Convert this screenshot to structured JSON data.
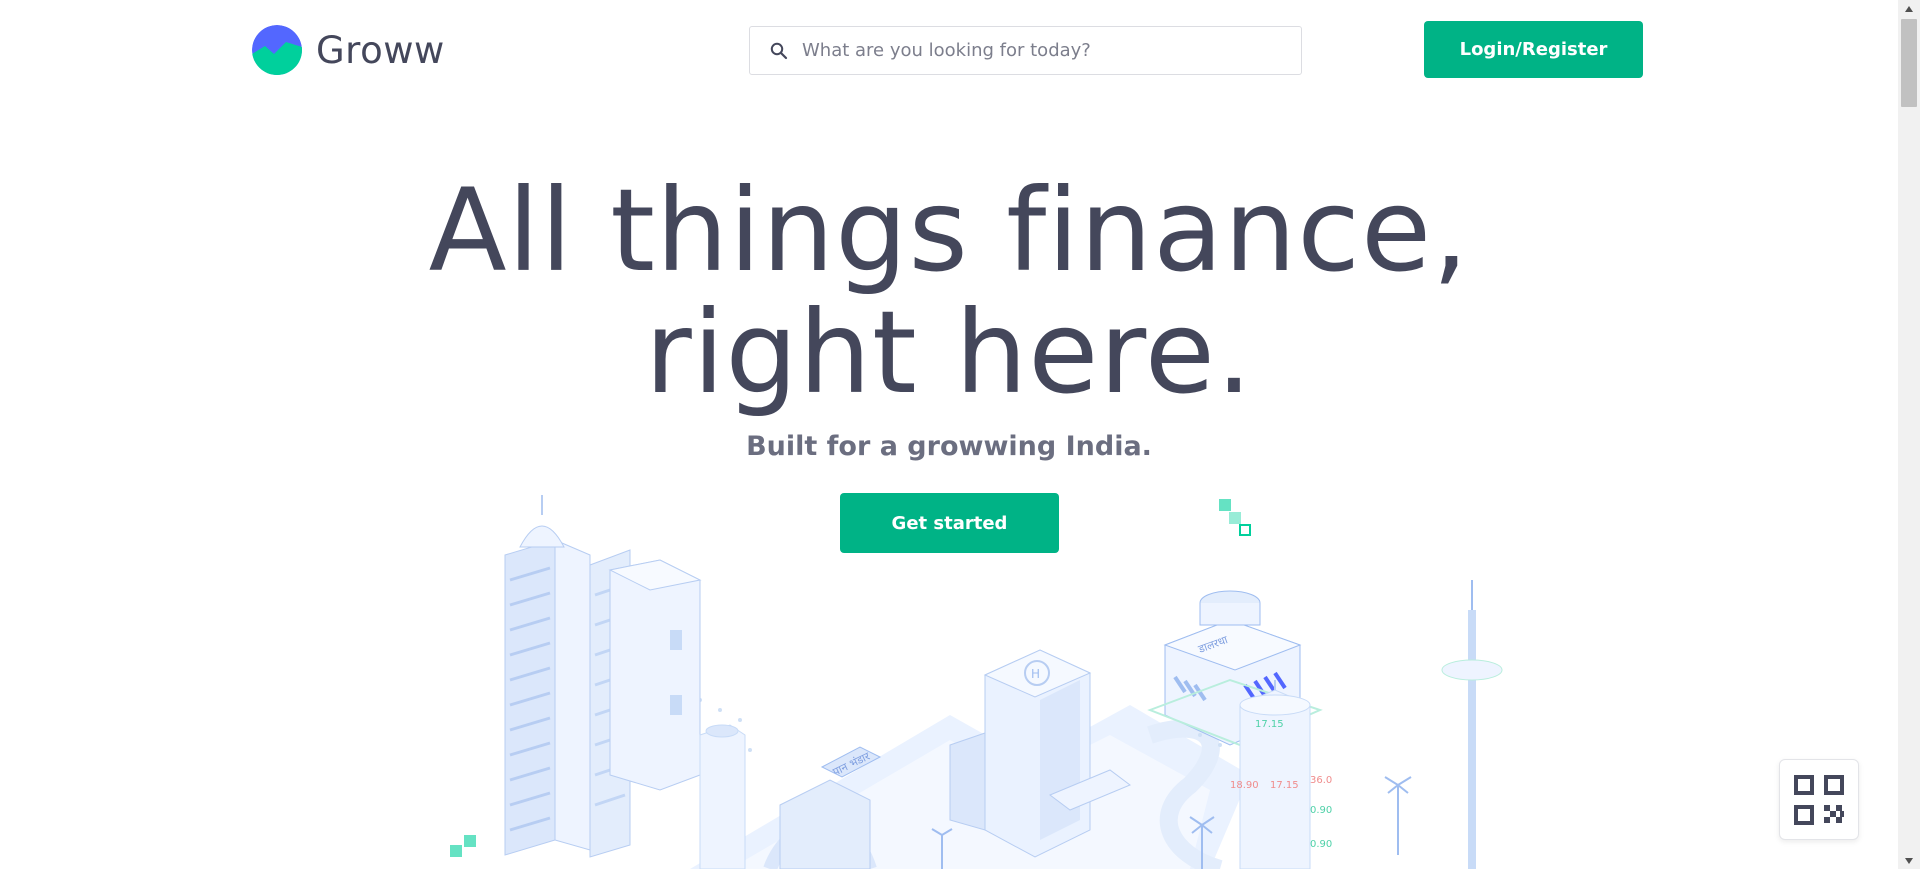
{
  "brand": {
    "name": "Groww",
    "primary_color": "#00b386",
    "logo_blue": "#5367ff",
    "text_color": "#44475b"
  },
  "search": {
    "placeholder": "What are you looking for today?",
    "value": ""
  },
  "header": {
    "login_label": "Login/Register"
  },
  "hero": {
    "title_line1": "All things finance,",
    "title_line2": "right here.",
    "subtitle": "Built for a growwing India.",
    "cta_label": "Get started"
  },
  "illustration": {
    "labels": {
      "shop_sign": "डालरधा",
      "post_sign": "पान भंडार"
    },
    "ticker_values": [
      "17.15",
      "18.90",
      "17.15",
      "36.0",
      "0.90",
      "0.90"
    ]
  },
  "qr": {
    "icon": "qr-code-icon"
  }
}
